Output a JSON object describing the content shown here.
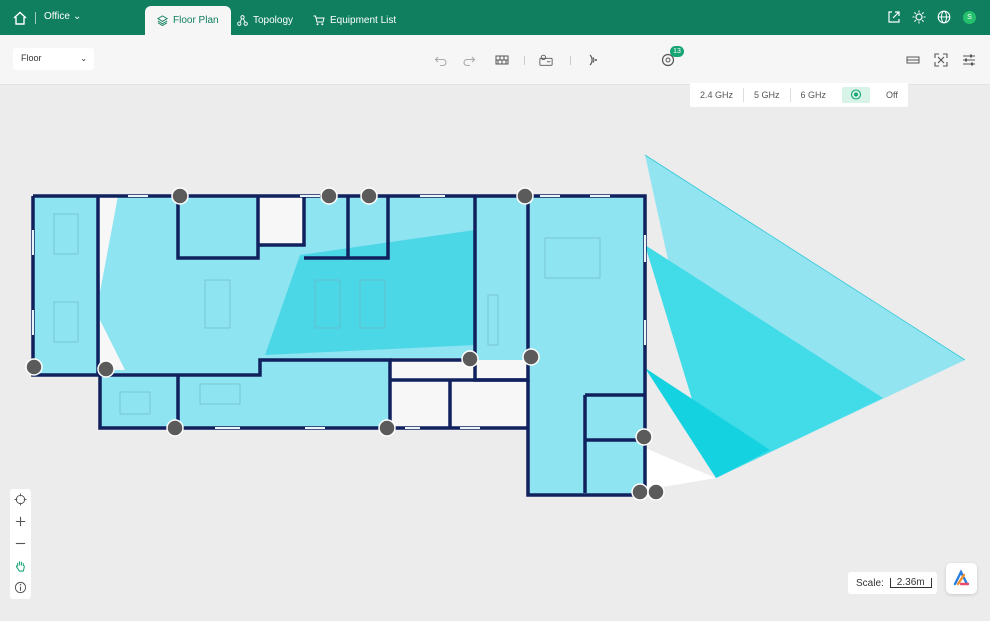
{
  "header": {
    "site_name": "Office",
    "tabs": [
      {
        "label": "Floor Plan",
        "active": true
      },
      {
        "label": "Topology",
        "active": false
      },
      {
        "label": "Equipment List",
        "active": false
      }
    ],
    "avatar_letter": "S",
    "accent_color": "#0f7f5f"
  },
  "toolbar": {
    "floor_select": "Floor",
    "device_count": "13",
    "bands": [
      "2.4 GHz",
      "5 GHz",
      "6 GHz"
    ],
    "band_off": "Off"
  },
  "map": {
    "scale_label": "Scale:",
    "scale_value": "2.36m",
    "coverage_color": "#7fe2ee",
    "coverage_strong_color": "#14d2e0"
  }
}
